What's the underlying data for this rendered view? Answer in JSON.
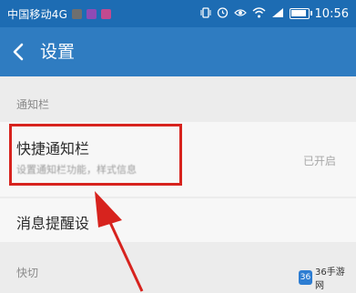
{
  "status_bar": {
    "carrier": "中国移动4G",
    "time": "10:56",
    "icons": [
      "vibrate-icon",
      "alarm-icon",
      "eye-icon",
      "wifi-icon",
      "signal-icon",
      "battery-icon"
    ],
    "notification_icons": [
      "#6f6f6f",
      "#8e4bb5",
      "#c24a8f"
    ]
  },
  "header": {
    "back_icon": "chevron-left-icon",
    "title": "设置"
  },
  "sections": {
    "notify_bar": "通知栏",
    "shortcut": "快切"
  },
  "quick_notify": {
    "title": "快捷通知栏",
    "description": "设置通知栏功能，样式信息",
    "status": "已开启"
  },
  "reminder": {
    "title": "消息提醒设"
  },
  "annotation": {
    "highlight_color": "#d7231e"
  },
  "watermark": {
    "logo": "36",
    "text": "36手游网"
  },
  "colors": {
    "status_bar": "#1d6cb3",
    "title_bar": "#2f7cc1",
    "background": "#ececec"
  }
}
